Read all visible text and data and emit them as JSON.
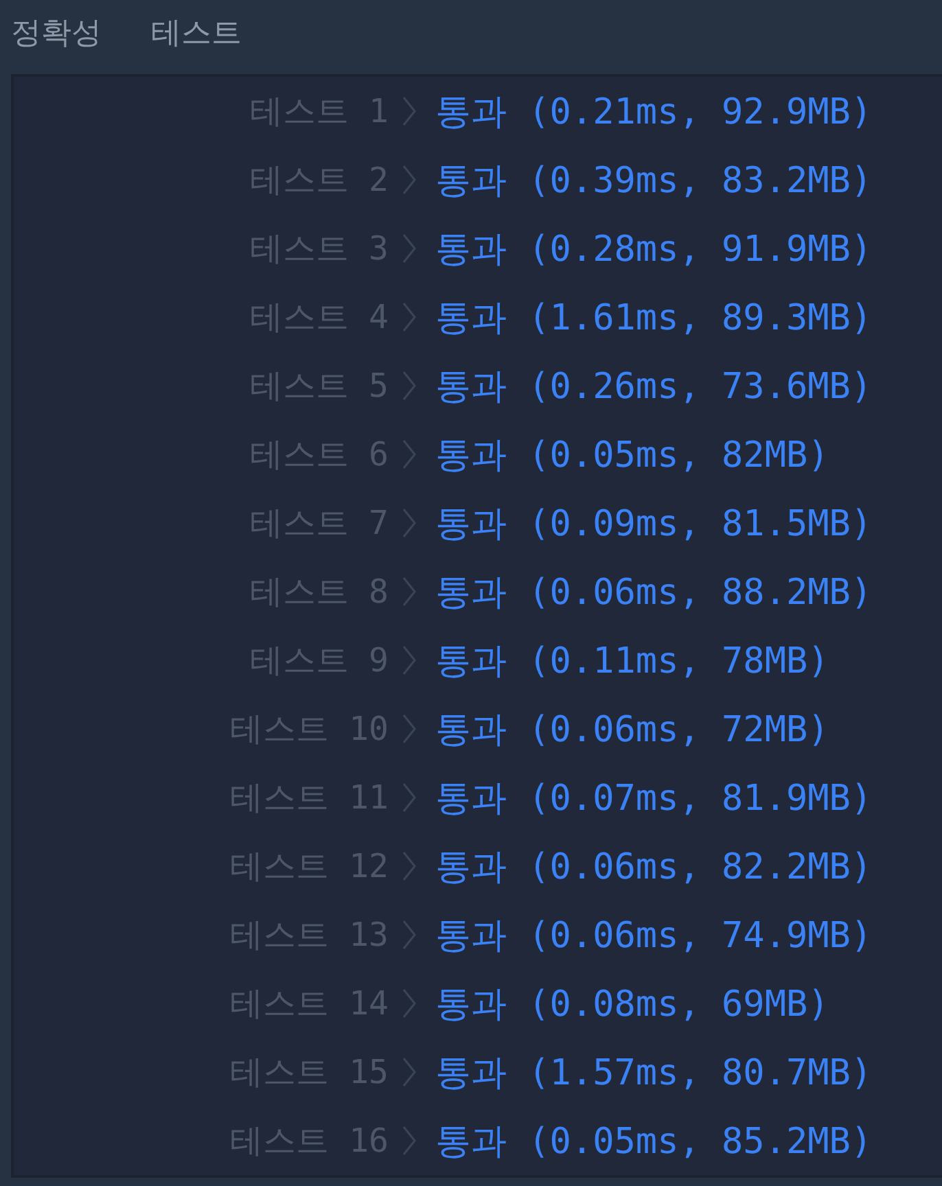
{
  "header": {
    "title": "정확성",
    "subtitle": "테스트"
  },
  "rows": [
    {
      "label": "테스트 1",
      "result": "통과 (0.21ms, 92.9MB)"
    },
    {
      "label": "테스트 2",
      "result": "통과 (0.39ms, 83.2MB)"
    },
    {
      "label": "테스트 3",
      "result": "통과 (0.28ms, 91.9MB)"
    },
    {
      "label": "테스트 4",
      "result": "통과 (1.61ms, 89.3MB)"
    },
    {
      "label": "테스트 5",
      "result": "통과 (0.26ms, 73.6MB)"
    },
    {
      "label": "테스트 6",
      "result": "통과 (0.05ms, 82MB)"
    },
    {
      "label": "테스트 7",
      "result": "통과 (0.09ms, 81.5MB)"
    },
    {
      "label": "테스트 8",
      "result": "통과 (0.06ms, 88.2MB)"
    },
    {
      "label": "테스트 9",
      "result": "통과 (0.11ms, 78MB)"
    },
    {
      "label": "테스트 10",
      "result": "통과 (0.06ms, 72MB)"
    },
    {
      "label": "테스트 11",
      "result": "통과 (0.07ms, 81.9MB)"
    },
    {
      "label": "테스트 12",
      "result": "통과 (0.06ms, 82.2MB)"
    },
    {
      "label": "테스트 13",
      "result": "통과 (0.06ms, 74.9MB)"
    },
    {
      "label": "테스트 14",
      "result": "통과 (0.08ms, 69MB)"
    },
    {
      "label": "테스트 15",
      "result": "통과 (1.57ms, 80.7MB)"
    },
    {
      "label": "테스트 16",
      "result": "통과 (0.05ms, 85.2MB)"
    }
  ]
}
